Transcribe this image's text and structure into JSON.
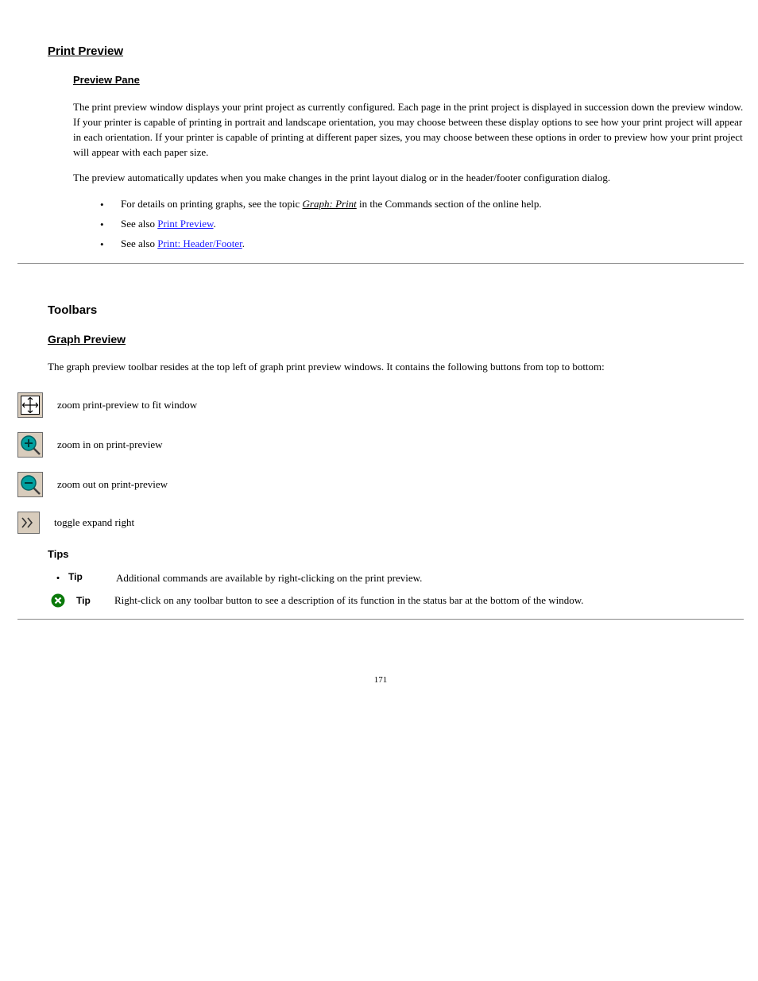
{
  "section1": {
    "title": "Print Preview",
    "sub": "Preview Pane",
    "para1": "The print preview window displays your print project as currently configured. Each page in the print project is displayed in succession down the preview window. If your printer is capable of printing in portrait and landscape orientation, you may choose between these display options to see how your print project will appear in each orientation. If your printer is capable of printing at different paper sizes, you may choose between these options in order to preview how your print project will appear with each paper size.",
    "para2": "The preview automatically updates when you make changes in the print layout dialog or in the header/footer configuration dialog.",
    "bullets": [
      {
        "dot": "•",
        "prefix": "For details on printing graphs, see the topic ",
        "link": "Graph: Print",
        "suffix": " in the Commands section of the online help."
      },
      {
        "dot": "•",
        "prefix": "See also ",
        "link": "Print Preview",
        "suffix": "."
      },
      {
        "dot": "•",
        "prefix": "See also ",
        "link": "Print: Header/Footer",
        "suffix": "."
      }
    ]
  },
  "section2": {
    "title": "Toolbars",
    "sub": "Graph Preview",
    "intro": "The graph preview toolbar resides at the top left of graph print preview windows. It contains the following buttons from top to bottom:",
    "icons": [
      {
        "name": "zoom-to-fit-icon",
        "label": "zoom print-preview to fit window"
      },
      {
        "name": "zoom-in-icon",
        "label": "zoom in on print-preview"
      },
      {
        "name": "zoom-out-icon",
        "label": "zoom out on print-preview"
      },
      {
        "name": "toggle-expand-icon",
        "label": "toggle expand right"
      }
    ],
    "tipsHeading": "Tips",
    "tips": [
      {
        "label": "Tip",
        "text": "Additional commands are available by right-clicking on the print preview."
      },
      {
        "label": "Tip",
        "text": "Right-click on any toolbar button to see a description of its function in the status bar at the bottom of the window."
      }
    ]
  },
  "pageNumber": "171"
}
